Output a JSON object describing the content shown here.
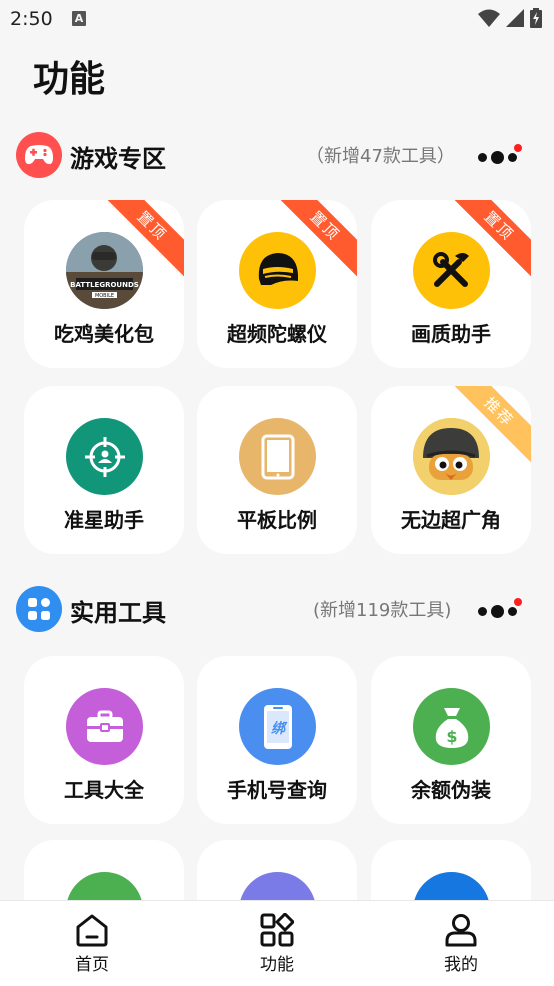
{
  "status": {
    "time": "2:50",
    "notification_letter": "A"
  },
  "page": {
    "title": "功能"
  },
  "sections": [
    {
      "title": "游戏专区",
      "subtitle": "（新增47款工具）",
      "items": [
        {
          "label": "吃鸡美化包",
          "badge": "置顶",
          "icon": "battlegrounds-mobile-logo"
        },
        {
          "label": "超频陀螺仪",
          "badge": "置顶",
          "icon": "helmet-icon"
        },
        {
          "label": "画质助手",
          "badge": "置顶",
          "icon": "tools-icon"
        },
        {
          "label": "准星助手",
          "badge": "",
          "icon": "crosshair-icon"
        },
        {
          "label": "平板比例",
          "badge": "",
          "icon": "tablet-icon"
        },
        {
          "label": "无边超广角",
          "badge": "推荐",
          "icon": "duck-helmet-avatar"
        }
      ]
    },
    {
      "title": "实用工具",
      "subtitle": "(新增119款工具)",
      "items": [
        {
          "label": "工具大全",
          "icon": "toolbox-icon"
        },
        {
          "label": "手机号查询",
          "icon": "phone-bind-icon",
          "icon_text": "绑"
        },
        {
          "label": "余额伪装",
          "icon": "money-bag-icon"
        },
        {
          "label": "",
          "icon": "green-partial-icon"
        },
        {
          "label": "",
          "icon": "purple-partial-icon"
        },
        {
          "label": "",
          "icon": "blue-partial-icon"
        }
      ]
    }
  ],
  "nav": [
    {
      "label": "首页",
      "icon": "home-icon"
    },
    {
      "label": "功能",
      "icon": "grid-icon"
    },
    {
      "label": "我的",
      "icon": "user-icon"
    }
  ],
  "colors": {
    "game_section": "#ff4f4f",
    "tools_section": "#2f8ef0",
    "ribbon_top": "#ff5b2e",
    "ribbon_recommend": "#ffc25c"
  }
}
